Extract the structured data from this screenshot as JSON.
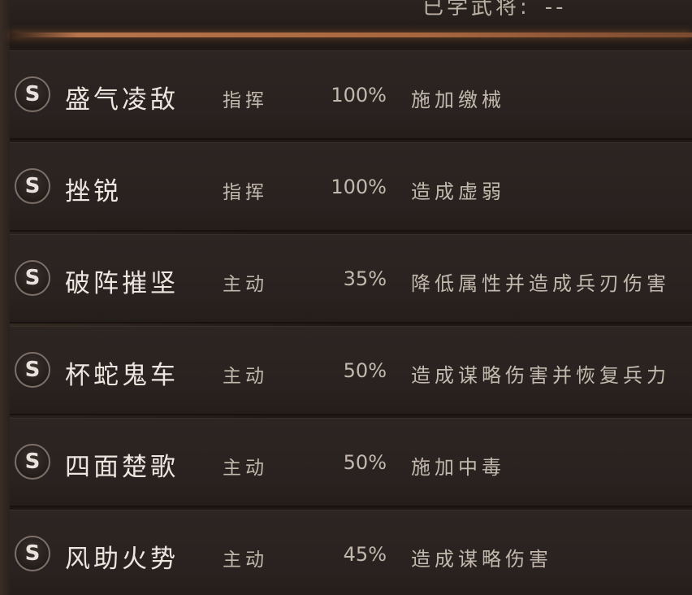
{
  "header": {
    "learned_label": "已学武将:",
    "learned_value": "--"
  },
  "skills": [
    {
      "grade": "S",
      "name": "盛气凌敌",
      "type": "指挥",
      "rate": "100%",
      "effect": "施加缴械"
    },
    {
      "grade": "S",
      "name": "挫锐",
      "type": "指挥",
      "rate": "100%",
      "effect": "造成虚弱"
    },
    {
      "grade": "S",
      "name": "破阵摧坚",
      "type": "主动",
      "rate": "35%",
      "effect": "降低属性并造成兵刃伤害"
    },
    {
      "grade": "S",
      "name": "杯蛇鬼车",
      "type": "主动",
      "rate": "50%",
      "effect": "造成谋略伤害并恢复兵力"
    },
    {
      "grade": "S",
      "name": "四面楚歌",
      "type": "主动",
      "rate": "50%",
      "effect": "施加中毒"
    },
    {
      "grade": "S",
      "name": "风助火势",
      "type": "主动",
      "rate": "45%",
      "effect": "造成谋略伤害"
    }
  ],
  "colors": {
    "background": "#1c1714",
    "row_background": "#2a2220",
    "divider_glow": "#b8744a",
    "name_text": "#ece6df",
    "secondary_text": "#c2b8ad",
    "badge_border": "#7d7068"
  }
}
